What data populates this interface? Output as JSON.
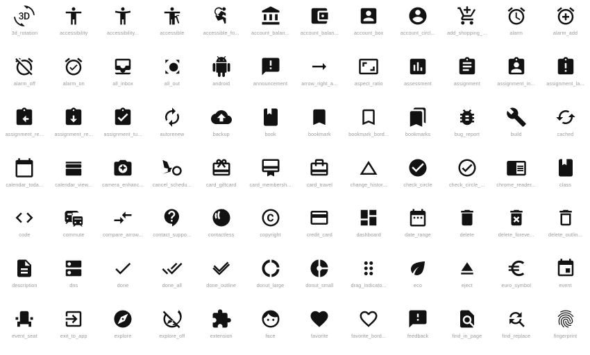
{
  "page": {
    "title": "Material Icons Gallery",
    "background_color": "#ffffff",
    "icon_color": "#121212",
    "label_color": "#9b9b9b",
    "columns": 12,
    "rows": 7,
    "total_icons": 84
  },
  "icons": [
    {
      "name": "3d_rotation",
      "label": "3d_rotation"
    },
    {
      "name": "accessibility",
      "label": "accessibility"
    },
    {
      "name": "accessibility_new",
      "label": "accessibility..."
    },
    {
      "name": "accessible",
      "label": "accessible"
    },
    {
      "name": "accessible_forward",
      "label": "accessible_fo..."
    },
    {
      "name": "account_balance",
      "label": "account_balan..."
    },
    {
      "name": "account_balance_wallet",
      "label": "account_balan..."
    },
    {
      "name": "account_box",
      "label": "account_box"
    },
    {
      "name": "account_circle",
      "label": "account_circl..."
    },
    {
      "name": "add_shopping_cart",
      "label": "add_shopping_..."
    },
    {
      "name": "alarm",
      "label": "alarm"
    },
    {
      "name": "alarm_add",
      "label": "alarm_add"
    },
    {
      "name": "alarm_off",
      "label": "alarm_off"
    },
    {
      "name": "alarm_on",
      "label": "alarm_on"
    },
    {
      "name": "all_inbox",
      "label": "all_inbox"
    },
    {
      "name": "all_out",
      "label": "all_out"
    },
    {
      "name": "android",
      "label": "android"
    },
    {
      "name": "announcement",
      "label": "announcement"
    },
    {
      "name": "arrow_right_alt",
      "label": "arrow_right_a..."
    },
    {
      "name": "aspect_ratio",
      "label": "aspect_ratio"
    },
    {
      "name": "assessment",
      "label": "assessment"
    },
    {
      "name": "assignment",
      "label": "assignment"
    },
    {
      "name": "assignment_ind",
      "label": "assignment_in..."
    },
    {
      "name": "assignment_late",
      "label": "assignment_la..."
    },
    {
      "name": "assignment_return",
      "label": "assignment_re..."
    },
    {
      "name": "assignment_returned",
      "label": "assignment_re..."
    },
    {
      "name": "assignment_turned_in",
      "label": "assignment_tu..."
    },
    {
      "name": "autorenew",
      "label": "autorenew"
    },
    {
      "name": "backup",
      "label": "backup"
    },
    {
      "name": "book",
      "label": "book"
    },
    {
      "name": "bookmark",
      "label": "bookmark"
    },
    {
      "name": "bookmark_border",
      "label": "bookmark_bord..."
    },
    {
      "name": "bookmarks",
      "label": "bookmarks"
    },
    {
      "name": "bug_report",
      "label": "bug_report"
    },
    {
      "name": "build",
      "label": "build"
    },
    {
      "name": "cached",
      "label": "cached"
    },
    {
      "name": "calendar_today",
      "label": "calendar_toda..."
    },
    {
      "name": "calendar_view_day",
      "label": "calendar_view..."
    },
    {
      "name": "camera_enhance",
      "label": "camera_enhanc..."
    },
    {
      "name": "cancel_schedule_send",
      "label": "cancel_schedu..."
    },
    {
      "name": "card_giftcard",
      "label": "card_giftcard"
    },
    {
      "name": "card_membership",
      "label": "card_membersh..."
    },
    {
      "name": "card_travel",
      "label": "card_travel"
    },
    {
      "name": "change_history",
      "label": "change_histor..."
    },
    {
      "name": "check_circle",
      "label": "check_circle"
    },
    {
      "name": "check_circle_outline",
      "label": "check_circle_..."
    },
    {
      "name": "chrome_reader_mode",
      "label": "chrome_reader..."
    },
    {
      "name": "class",
      "label": "class"
    },
    {
      "name": "code",
      "label": "code"
    },
    {
      "name": "commute",
      "label": "commute"
    },
    {
      "name": "compare_arrows",
      "label": "compare_arrow..."
    },
    {
      "name": "contact_support",
      "label": "contact_suppo..."
    },
    {
      "name": "contactless",
      "label": "contactless"
    },
    {
      "name": "copyright",
      "label": "copyright"
    },
    {
      "name": "credit_card",
      "label": "credit_card"
    },
    {
      "name": "dashboard",
      "label": "dashboard"
    },
    {
      "name": "date_range",
      "label": "date_range"
    },
    {
      "name": "delete",
      "label": "delete"
    },
    {
      "name": "delete_forever",
      "label": "delete_foreve..."
    },
    {
      "name": "delete_outline",
      "label": "delete_outlin..."
    },
    {
      "name": "description",
      "label": "description"
    },
    {
      "name": "dns",
      "label": "dns"
    },
    {
      "name": "done",
      "label": "done"
    },
    {
      "name": "done_all",
      "label": "done_all"
    },
    {
      "name": "done_outline",
      "label": "done_outline"
    },
    {
      "name": "donut_large",
      "label": "donut_large"
    },
    {
      "name": "donut_small",
      "label": "donut_small"
    },
    {
      "name": "drag_indicator",
      "label": "drag_indicato..."
    },
    {
      "name": "eco",
      "label": "eco"
    },
    {
      "name": "eject",
      "label": "eject"
    },
    {
      "name": "euro_symbol",
      "label": "euro_symbol"
    },
    {
      "name": "event",
      "label": "event"
    },
    {
      "name": "event_seat",
      "label": "event_seat"
    },
    {
      "name": "exit_to_app",
      "label": "exit_to_app"
    },
    {
      "name": "explore",
      "label": "explore"
    },
    {
      "name": "explore_off",
      "label": "explore_off"
    },
    {
      "name": "extension",
      "label": "extension"
    },
    {
      "name": "face",
      "label": "face"
    },
    {
      "name": "favorite",
      "label": "favorite"
    },
    {
      "name": "favorite_border",
      "label": "favorite_bord..."
    },
    {
      "name": "feedback",
      "label": "feedback"
    },
    {
      "name": "find_in_page",
      "label": "find_in_page"
    },
    {
      "name": "find_replace",
      "label": "find_replace"
    },
    {
      "name": "fingerprint",
      "label": "fingerprint"
    }
  ]
}
